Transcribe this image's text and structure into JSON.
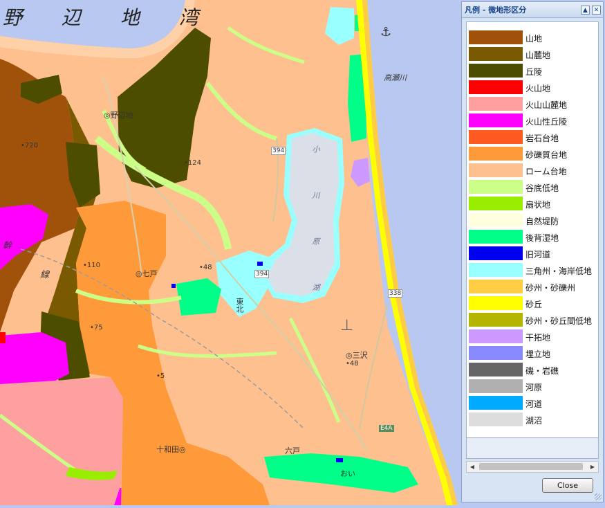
{
  "map": {
    "bay_label": "野 辺 地 湾",
    "place_labels": {
      "noheji": "◎野辺地",
      "shichinohe": "◎七戸",
      "tohoku": "東北",
      "misawa": "◎三沢",
      "towada": "十和田◎",
      "rokunohe": "六戸",
      "oirase": "おい",
      "takase_river": "高瀬川"
    },
    "lake_label": "小 川 原 湖",
    "elevations": {
      "e720": "•720",
      "e124": "•124",
      "e110": "•110",
      "e48a": "•48",
      "e75": "•75",
      "e48b": "•48",
      "e5": "•5"
    },
    "route_shields": {
      "r394a": "394",
      "r394b": "394",
      "r338": "338",
      "e4a": "E4A"
    },
    "symbols": {
      "kan": "幹",
      "sen": "線"
    }
  },
  "legend": {
    "title": "凡例 - 微地形区分",
    "collapse_glyph": "▲",
    "close_glyph": "✕",
    "items": [
      {
        "label": "山地",
        "color": "#a0520a"
      },
      {
        "label": "山麓地",
        "color": "#7a5a00"
      },
      {
        "label": "丘陵",
        "color": "#4d4d00"
      },
      {
        "label": "火山地",
        "color": "#ff0000"
      },
      {
        "label": "火山山麓地",
        "color": "#ffa0a0"
      },
      {
        "label": "火山性丘陵",
        "color": "#ff00ff"
      },
      {
        "label": "岩石台地",
        "color": "#ff5a22"
      },
      {
        "label": "砂礫質台地",
        "color": "#ff9a3a"
      },
      {
        "label": "ローム台地",
        "color": "#ffc090"
      },
      {
        "label": "谷底低地",
        "color": "#ccff88"
      },
      {
        "label": "扇状地",
        "color": "#99ee00"
      },
      {
        "label": "自然堤防",
        "color": "#ffffdd"
      },
      {
        "label": "後背湿地",
        "color": "#00ff88"
      },
      {
        "label": "旧河道",
        "color": "#0000ee"
      },
      {
        "label": "三角州・海岸低地",
        "color": "#99ffff"
      },
      {
        "label": "砂州・砂礫州",
        "color": "#ffcc44"
      },
      {
        "label": "砂丘",
        "color": "#ffff00"
      },
      {
        "label": "砂州・砂丘間低地",
        "color": "#b5b500"
      },
      {
        "label": "干拓地",
        "color": "#cc99ff"
      },
      {
        "label": "埋立地",
        "color": "#8888ff"
      },
      {
        "label": "磯・岩礁",
        "color": "#666666"
      },
      {
        "label": "河原",
        "color": "#b0b0b0"
      },
      {
        "label": "河道",
        "color": "#00aaff"
      },
      {
        "label": "湖沼",
        "color": "#dddddd"
      }
    ],
    "scroll_left": "◀",
    "scroll_right": "▶",
    "close_button": "Close"
  }
}
